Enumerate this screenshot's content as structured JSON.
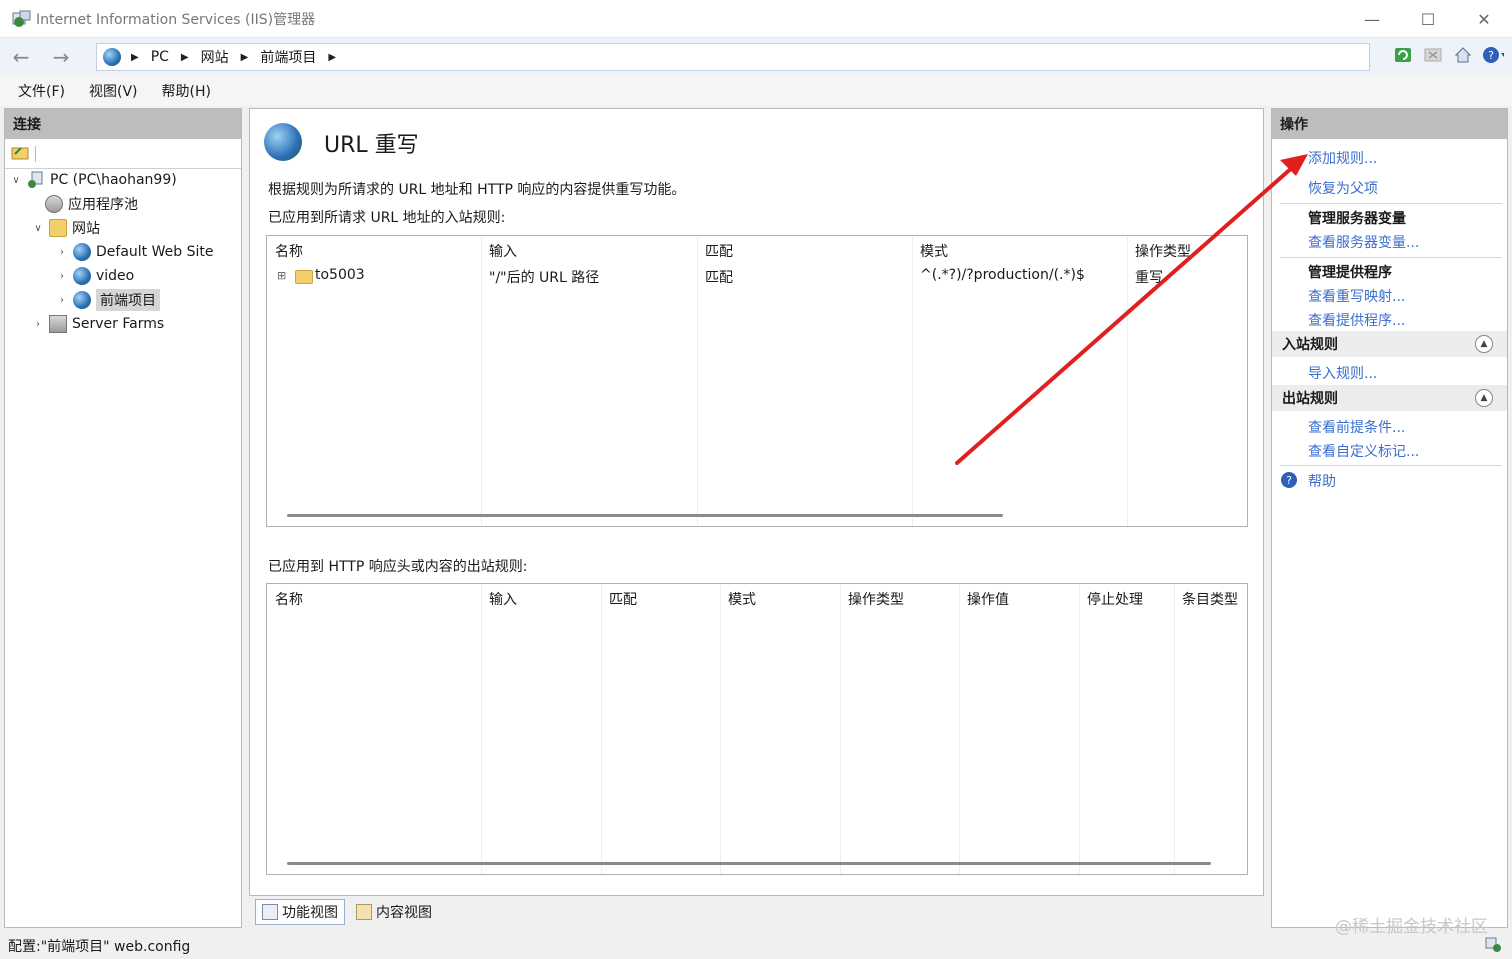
{
  "window": {
    "title": "Internet Information Services (IIS)管理器",
    "minimize": "—",
    "maximize": "☐",
    "close": "✕"
  },
  "address": {
    "crumbs": [
      "PC",
      "网站",
      "前端项目"
    ]
  },
  "menu": {
    "file": "文件(F)",
    "view": "视图(V)",
    "help": "帮助(H)"
  },
  "connections": {
    "header": "连接",
    "tree": [
      {
        "label": "PC (PC\\haohan99)"
      },
      {
        "label": "应用程序池"
      },
      {
        "label": "网站"
      },
      {
        "label": "Default Web Site"
      },
      {
        "label": "video"
      },
      {
        "label": "前端项目"
      },
      {
        "label": "Server Farms"
      }
    ]
  },
  "main": {
    "title": "URL 重写",
    "description": "根据规则为所请求的 URL 地址和 HTTP 响应的内容提供重写功能。",
    "inbound_label": "已应用到所请求 URL 地址的入站规则:",
    "inbound_columns": [
      "名称",
      "输入",
      "匹配",
      "模式",
      "操作类型"
    ],
    "inbound_rows": [
      {
        "name": "to5003",
        "input": "\"/\"后的 URL 路径",
        "match": "匹配",
        "pattern": "^(.*?)/?production/(.*)$",
        "action": "重写"
      }
    ],
    "outbound_label": "已应用到 HTTP 响应头或内容的出站规则:",
    "outbound_columns": [
      "名称",
      "输入",
      "匹配",
      "模式",
      "操作类型",
      "操作值",
      "停止处理",
      "条目类型"
    ]
  },
  "view_tabs": {
    "features": "功能视图",
    "content": "内容视图"
  },
  "actions": {
    "header": "操作",
    "add_rule": "添加规则...",
    "revert_parent": "恢复为父项",
    "server_vars_title": "管理服务器变量",
    "view_server_vars": "查看服务器变量...",
    "providers_title": "管理提供程序",
    "view_rewrite_maps": "查看重写映射...",
    "view_providers": "查看提供程序...",
    "inbound_section": "入站规则",
    "import_rules": "导入规则...",
    "outbound_section": "出站规则",
    "view_preconditions": "查看前提条件...",
    "view_custom_tags": "查看自定义标记...",
    "help": "帮助"
  },
  "status": {
    "text": "配置:\"前端项目\" web.config",
    "watermark": "@稀土掘金技术社区"
  },
  "annotation": {
    "arrow_color": "#e02020"
  }
}
